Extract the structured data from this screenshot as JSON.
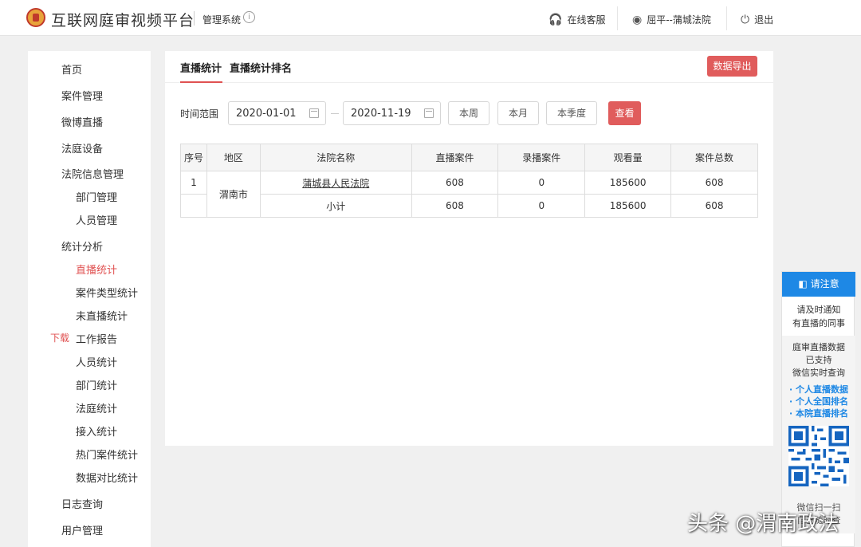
{
  "header": {
    "app_title": "互联网庭审视频平台",
    "system_label": "管理系统",
    "info_icon": "info-icon",
    "support_label": "在线客服",
    "user_label": "屈平--蒲城法院",
    "logout_label": "退出",
    "logo_icon": "court-emblem-icon"
  },
  "sidebar": {
    "items": [
      {
        "label": "首页"
      },
      {
        "label": "案件管理"
      },
      {
        "label": "微博直播"
      },
      {
        "label": "法庭设备"
      },
      {
        "label": "法院信息管理"
      },
      {
        "label": "部门管理"
      },
      {
        "label": "人员管理"
      },
      {
        "label": "统计分析"
      },
      {
        "label": "直播统计"
      },
      {
        "label": "案件类型统计"
      },
      {
        "label": "未直播统计"
      },
      {
        "label": "工作报告"
      },
      {
        "label": "人员统计"
      },
      {
        "label": "部门统计"
      },
      {
        "label": "法庭统计"
      },
      {
        "label": "接入统计"
      },
      {
        "label": "热门案件统计"
      },
      {
        "label": "数据对比统计"
      },
      {
        "label": "日志查询"
      },
      {
        "label": "用户管理"
      }
    ],
    "download_badge": "下载"
  },
  "main": {
    "tabs": [
      {
        "label": "直播统计"
      },
      {
        "label": "直播统计排名"
      }
    ],
    "export_label": "数据导出",
    "filter": {
      "range_label": "时间范围",
      "start_date": "2020-01-01",
      "end_date": "2020-11-19",
      "week_label": "本周",
      "month_label": "本月",
      "quarter_label": "本季度",
      "query_label": "查看"
    },
    "table": {
      "headers": [
        "序号",
        "地区",
        "法院名称",
        "直播案件",
        "录播案件",
        "观看量",
        "案件总数"
      ],
      "row1": {
        "index": "1",
        "region": "渭南市",
        "court": "蒲城县人民法院",
        "live": "608",
        "recorded": "0",
        "views": "185600",
        "total": "608"
      },
      "subtotal": {
        "label": "小计",
        "live": "608",
        "recorded": "0",
        "views": "185600",
        "total": "608"
      }
    }
  },
  "notice": {
    "title": "请注意",
    "line1": "请及时通知",
    "line2": "有直播的同事",
    "line3": "庭审直播数据",
    "line4": "已支持",
    "line5": "微信实时查询",
    "bullet1": "· 个人直播数据",
    "bullet2": "· 个人全国排名",
    "bullet3": "· 本院直播排名",
    "scan1": "微信扫一扫",
    "scan2": "自己随时查"
  },
  "watermark": "头条 @渭南政法",
  "colors": {
    "accent": "#e05c5c",
    "notice_blue": "#1e88e5"
  }
}
